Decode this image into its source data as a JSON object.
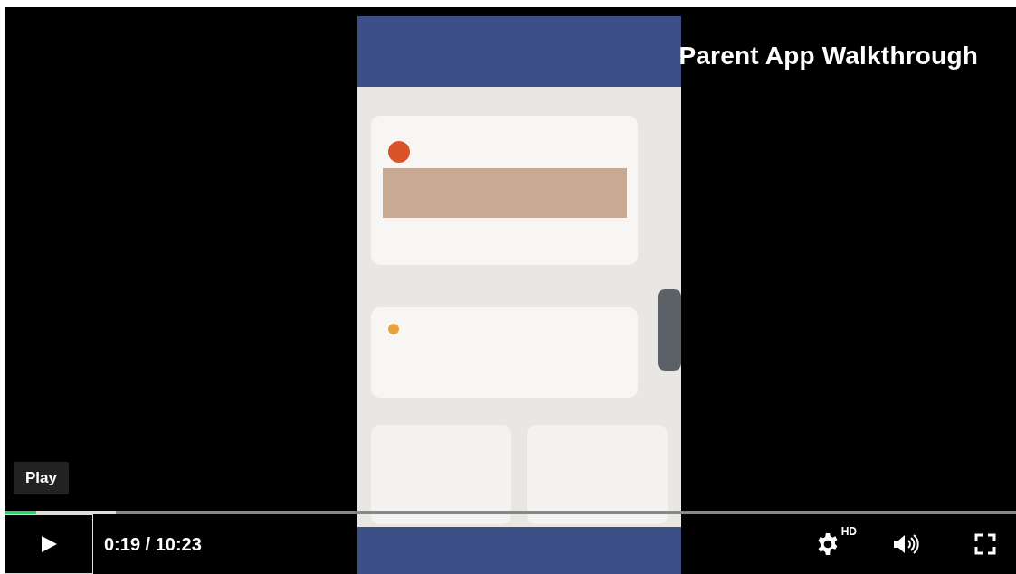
{
  "video": {
    "kind": "picture",
    "title": "Parent App Walkthrough"
  },
  "tooltip": {
    "text": "Play"
  },
  "progress": {
    "level": 0.031,
    "buffered": {
      "level": 0.11
    }
  },
  "controls": {
    "play_focused": true,
    "time": "0:19 / 10:23",
    "quality_badge": "HD"
  }
}
